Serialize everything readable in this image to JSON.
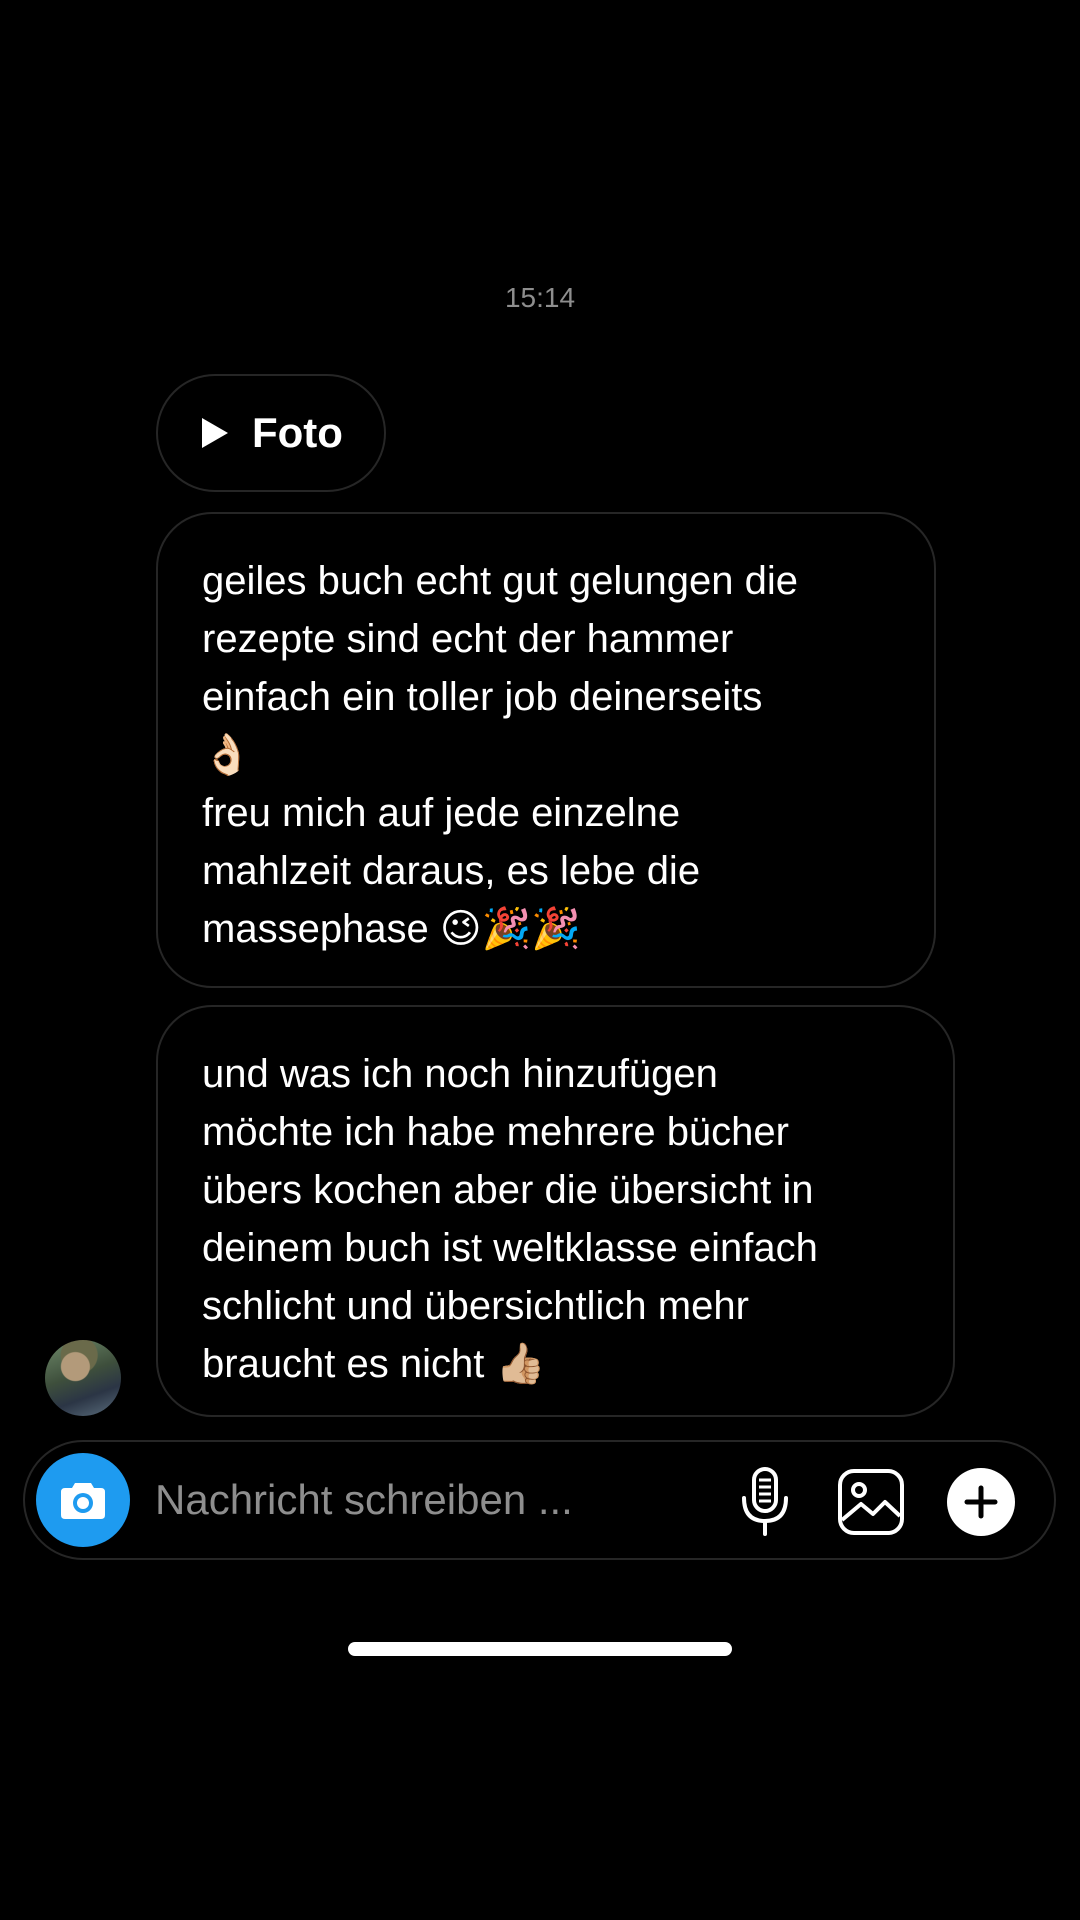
{
  "thread": {
    "timestamp": "15:14"
  },
  "attachment": {
    "label": "Foto",
    "icon": "play-icon"
  },
  "messages": [
    {
      "text": "geiles buch echt gut gelungen die\nrezepte sind echt der hammer\neinfach ein toller job deinerseits\n👌🏻\nfreu mich auf jede einzelne\nmahlzeit daraus, es lebe die\nmassephase 😉🎉🎉"
    },
    {
      "text": "und was ich noch hinzufügen\nmöchte ich habe mehrere bücher\nübers kochen aber die übersicht in\ndeinem buch ist weltklasse einfach\nschlicht und übersichtlich mehr\nbraucht es nicht 👍🏼"
    }
  ],
  "sender": {
    "avatar": "avatar-photo"
  },
  "composer": {
    "placeholder": "Nachricht schreiben ...",
    "value": "",
    "camera_icon": "camera-icon",
    "mic_icon": "microphone-icon",
    "gallery_icon": "image-gallery-icon",
    "plus_icon": "plus-icon",
    "accent_color": "#1e9bf0"
  },
  "colors": {
    "background": "#000000",
    "bubble_border": "#262626",
    "muted_text": "#8e8e8e"
  }
}
